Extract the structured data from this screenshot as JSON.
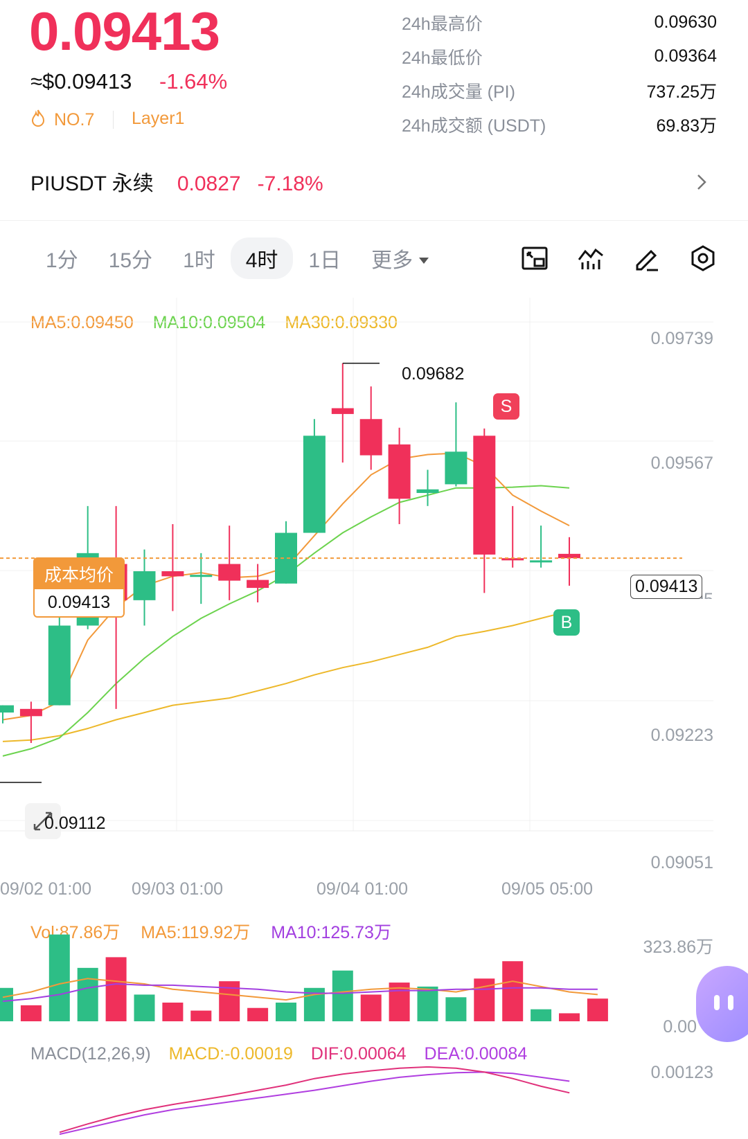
{
  "header": {
    "price": "0.09413",
    "usd_price": "≈$0.09413",
    "change_pct": "-1.64%",
    "rank": "NO.7",
    "tag": "Layer1"
  },
  "stats": [
    {
      "label": "24h最高价",
      "value": "0.09630"
    },
    {
      "label": "24h最低价",
      "value": "0.09364"
    },
    {
      "label": "24h成交量 (PI)",
      "value": "737.25万"
    },
    {
      "label": "24h成交额 (USDT)",
      "value": "69.83万"
    }
  ],
  "perpetual": {
    "name": "PIUSDT 永续",
    "price": "0.0827",
    "change": "-7.18%"
  },
  "timeframes": {
    "items": [
      "1分",
      "15分",
      "1时",
      "4时",
      "1日"
    ],
    "active": "4时",
    "more_label": "更多"
  },
  "toolbar_icons": [
    "fullscreen-icon",
    "indicator-icon",
    "draw-icon",
    "settings-icon"
  ],
  "ma_legend": {
    "ma5": "MA5:0.09450",
    "ma10": "MA10:0.09504",
    "ma30": "MA30:0.09330"
  },
  "main_chart": {
    "y_ticks": [
      "0.09739",
      "0.09567",
      "0.09395",
      "0.09223",
      "0.09051"
    ],
    "x_ticks": [
      "09/02 01:00",
      "09/03 01:00",
      "09/04 01:00",
      "09/05 05:00"
    ],
    "high_marker": "0.09682",
    "low_marker": "0.09112",
    "cost_label": "成本均价",
    "cost_value": "0.09413",
    "current_price": "0.09413",
    "sell_marker": "S",
    "buy_marker": "B"
  },
  "volume": {
    "vol": "Vol:87.86万",
    "ma5": "MA5:119.92万",
    "ma10": "MA10:125.73万",
    "y_top": "323.86万",
    "y_bottom": "0.00"
  },
  "macd": {
    "title": "MACD(12,26,9)",
    "macd": "MACD:-0.00019",
    "dif": "DIF:0.00064",
    "dea": "DEA:0.00084",
    "y_top": "0.00123"
  },
  "colors": {
    "up": "#2DBE86",
    "down": "#F0305A",
    "ma5": "#F2993A",
    "ma10": "#6CD34E",
    "ma30": "#EDB82A",
    "macd_dif": "#E0307A",
    "macd_dea": "#B03EE0",
    "vol_ma10": "#A23FE0"
  },
  "candles": [
    {
      "o": 0.092,
      "c": 0.0921,
      "h": 0.0921,
      "l": 0.09185
    },
    {
      "o": 0.09205,
      "c": 0.09195,
      "h": 0.09215,
      "l": 0.09158
    },
    {
      "o": 0.0921,
      "c": 0.0932,
      "h": 0.09375,
      "l": 0.0921
    },
    {
      "o": 0.0932,
      "c": 0.0942,
      "h": 0.09485,
      "l": 0.09315
    },
    {
      "o": 0.09405,
      "c": 0.09355,
      "h": 0.09485,
      "l": 0.09205
    },
    {
      "o": 0.09355,
      "c": 0.09395,
      "h": 0.09425,
      "l": 0.0932
    },
    {
      "o": 0.09395,
      "c": 0.09388,
      "h": 0.0946,
      "l": 0.0934
    },
    {
      "o": 0.0939,
      "c": 0.0939,
      "h": 0.0942,
      "l": 0.0935
    },
    {
      "o": 0.09405,
      "c": 0.09382,
      "h": 0.09458,
      "l": 0.09355
    },
    {
      "o": 0.09383,
      "c": 0.09372,
      "h": 0.09405,
      "l": 0.09352
    },
    {
      "o": 0.09378,
      "c": 0.09448,
      "h": 0.09464,
      "l": 0.09378
    },
    {
      "o": 0.09448,
      "c": 0.09582,
      "h": 0.09605,
      "l": 0.09448
    },
    {
      "o": 0.0962,
      "c": 0.09612,
      "h": 0.09682,
      "l": 0.09545
    },
    {
      "o": 0.09605,
      "c": 0.09555,
      "h": 0.0965,
      "l": 0.09535
    },
    {
      "o": 0.0957,
      "c": 0.09495,
      "h": 0.09593,
      "l": 0.0946
    },
    {
      "o": 0.09503,
      "c": 0.09508,
      "h": 0.09535,
      "l": 0.09485
    },
    {
      "o": 0.09515,
      "c": 0.0956,
      "h": 0.09628,
      "l": 0.09512
    },
    {
      "o": 0.09582,
      "c": 0.09418,
      "h": 0.09592,
      "l": 0.09365
    },
    {
      "o": 0.09413,
      "c": 0.0941,
      "h": 0.09485,
      "l": 0.094
    },
    {
      "o": 0.09408,
      "c": 0.0941,
      "h": 0.09458,
      "l": 0.094
    },
    {
      "o": 0.09419,
      "c": 0.09413,
      "h": 0.09442,
      "l": 0.09375
    }
  ],
  "ma5_line": [
    0.0919,
    0.09196,
    0.09215,
    0.093,
    0.09345,
    0.09375,
    0.09388,
    0.09393,
    0.09386,
    0.09388,
    0.094,
    0.09444,
    0.09488,
    0.09528,
    0.0955,
    0.09556,
    0.09558,
    0.0954,
    0.095,
    0.09478,
    0.09458
  ],
  "ma10_line": [
    0.0914,
    0.0915,
    0.09165,
    0.092,
    0.0924,
    0.09275,
    0.09305,
    0.0933,
    0.0935,
    0.09368,
    0.0939,
    0.0942,
    0.09448,
    0.0947,
    0.0949,
    0.095,
    0.0951,
    0.0951,
    0.09511,
    0.09513,
    0.0951
  ],
  "ma30_line": [
    0.0916,
    0.09162,
    0.09168,
    0.09178,
    0.0919,
    0.092,
    0.0921,
    0.09215,
    0.0922,
    0.0923,
    0.0924,
    0.09252,
    0.09262,
    0.0927,
    0.0928,
    0.0929,
    0.09305,
    0.09312,
    0.0932,
    0.0933,
    0.0934
  ],
  "volumes": [
    25,
    12,
    65,
    40,
    48,
    20,
    14,
    8,
    30,
    10,
    14,
    25,
    38,
    20,
    29,
    26,
    18,
    32,
    45,
    9,
    6,
    17
  ],
  "vol_dirs": [
    "u",
    "d",
    "u",
    "u",
    "d",
    "u",
    "d",
    "d",
    "d",
    "d",
    "u",
    "u",
    "u",
    "d",
    "d",
    "u",
    "u",
    "d",
    "d",
    "u",
    "d",
    "d"
  ],
  "vol_ma5": [
    18,
    22,
    28,
    32,
    30,
    28,
    24,
    22,
    20,
    18,
    16,
    20,
    22,
    24,
    25,
    24,
    22,
    26,
    30,
    26,
    22,
    20
  ],
  "vol_ma10": [
    15,
    17,
    20,
    25,
    28,
    27,
    27,
    26,
    25,
    24,
    22,
    21,
    21,
    22,
    23,
    23,
    24,
    24,
    25,
    25,
    24,
    24
  ],
  "macd_dif": [
    5e-05,
    0.00018,
    0.0003,
    0.0004,
    0.00048,
    0.00055,
    0.00062,
    0.0007,
    0.00078,
    0.00088,
    0.00095,
    0.001,
    0.00104,
    0.00106,
    0.00104,
    0.00098,
    0.00088,
    0.00076,
    0.00066
  ],
  "macd_dea": [
    2e-05,
    0.00012,
    0.00022,
    0.00032,
    0.0004,
    0.00046,
    0.00052,
    0.00058,
    0.00064,
    0.0007,
    0.00077,
    0.00084,
    0.0009,
    0.00094,
    0.00097,
    0.00098,
    0.00096,
    0.0009,
    0.00084
  ]
}
